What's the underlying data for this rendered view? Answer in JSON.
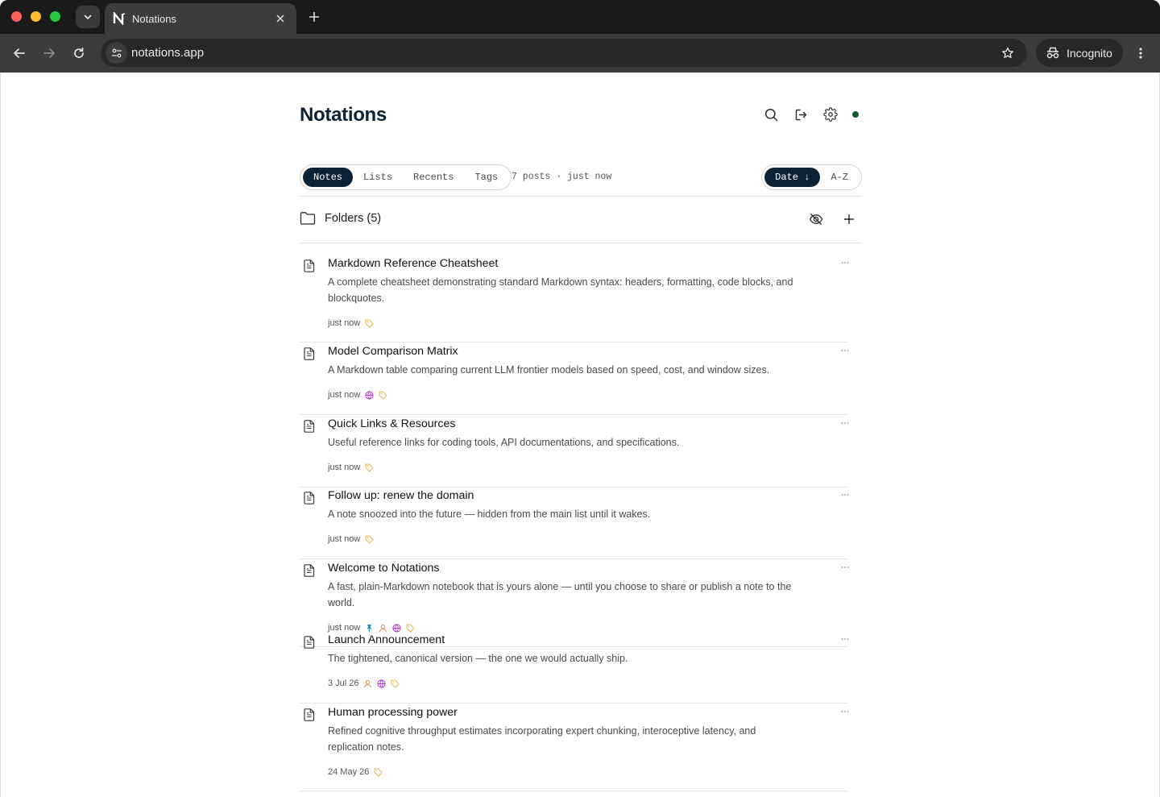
{
  "browser": {
    "tab_title": "Notations",
    "url": "notations.app",
    "incognito_label": "Incognito"
  },
  "app": {
    "logo": "Notations"
  },
  "tabs": [
    {
      "label": "Notes",
      "active": true
    },
    {
      "label": "Lists",
      "active": false
    },
    {
      "label": "Recents",
      "active": false
    },
    {
      "label": "Tags",
      "active": false
    }
  ],
  "meta_text": "7 posts · just now",
  "sort": {
    "date_label": "Date ↓",
    "az_label": "A-Z"
  },
  "folders_label": "Folders (5)",
  "notes": [
    {
      "title": "Markdown Reference Cheatsheet",
      "description": "A complete cheatsheet demonstrating standard Markdown syntax: headers, formatting, code blocks, and blockquotes.",
      "date": "just now",
      "icons": [
        "tag-icon"
      ]
    },
    {
      "title": "Model Comparison Matrix",
      "description": "A Markdown table comparing current LLM frontier models based on speed, cost, and window sizes.",
      "date": "just now",
      "icons": [
        "globe-icon",
        "tag-icon"
      ]
    },
    {
      "title": "Quick Links & Resources",
      "description": "Useful reference links for coding tools, API documentations, and specifications.",
      "date": "just now",
      "icons": [
        "tag-icon"
      ]
    },
    {
      "title": "Follow up: renew the domain",
      "description": "A note snoozed into the future — hidden from the main list until it wakes.",
      "date": "just now",
      "icons": [
        "tag-icon"
      ]
    },
    {
      "title": "Welcome to Notations",
      "description": "A fast, plain-Markdown notebook that is yours alone — until you choose to share or publish a note to the world.",
      "date": "just now",
      "icons": [
        "pin-icon",
        "person-icon",
        "globe-icon",
        "tag-icon"
      ]
    },
    {
      "title": "Launch Announcement",
      "description": "The tightened, canonical version — the one we would actually ship.",
      "date": "3 Jul 26",
      "icons": [
        "person-icon",
        "globe-icon",
        "tag-icon"
      ]
    },
    {
      "title": "Human processing power",
      "description": "Refined cognitive throughput estimates incorporating expert chunking, interoceptive latency, and replication notes.",
      "date": "24 May 26",
      "icons": [
        "tag-icon"
      ]
    }
  ],
  "colors": {
    "brand": "#0c2236",
    "status_dot": "#0e5b2a",
    "tag": "#e6b84a",
    "globe": "#b23ad1",
    "person": "#e0904a",
    "pin": "#1f8fd6"
  }
}
